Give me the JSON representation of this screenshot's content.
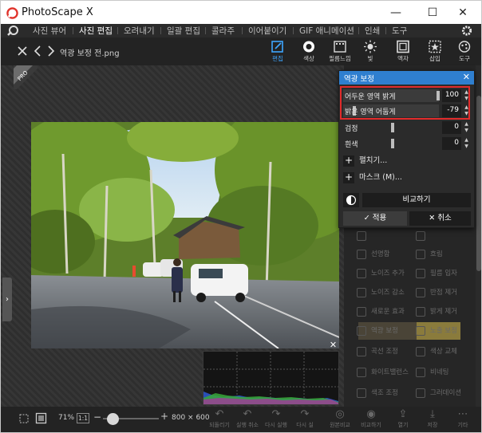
{
  "app": {
    "title": "PhotoScape X"
  },
  "window_controls": {
    "minimize": "—",
    "maximize": "☐",
    "close": "✕"
  },
  "menu": {
    "items": [
      {
        "label": "사진 뷰어",
        "active": false
      },
      {
        "label": "사진 편집",
        "active": true
      },
      {
        "label": "오려내기",
        "active": false
      },
      {
        "label": "일괄 편집",
        "active": false
      },
      {
        "label": "콜라주",
        "active": false
      },
      {
        "label": "이어붙이기",
        "active": false
      },
      {
        "label": "GIF 애니메이션",
        "active": false
      },
      {
        "label": "인쇄",
        "active": false
      },
      {
        "label": "도구",
        "active": false
      }
    ]
  },
  "toolbar": {
    "filename": "역광 보정 전.png",
    "tools": [
      {
        "label": "편집",
        "icon": "edit-icon",
        "active": true
      },
      {
        "label": "색상",
        "icon": "color-icon",
        "active": false
      },
      {
        "label": "필름느낌",
        "icon": "film-icon",
        "active": false
      },
      {
        "label": "빛",
        "icon": "light-icon",
        "active": false
      },
      {
        "label": "액자",
        "icon": "frame-icon",
        "active": false
      },
      {
        "label": "삽입",
        "icon": "insert-icon",
        "active": false
      },
      {
        "label": "도구",
        "icon": "tools-icon",
        "active": false
      }
    ]
  },
  "canvas": {
    "pro_badge": "PRO"
  },
  "dialog": {
    "title": "역광 보정",
    "sliders": [
      {
        "label": "어두운 영역 밝게",
        "value": "100",
        "level_fraction": 1.0
      },
      {
        "label": "밝은 영역 어둡게",
        "value": "-79",
        "level_fraction": 0.11
      },
      {
        "label": "검정",
        "value": "0",
        "level_fraction": 0.5
      },
      {
        "label": "흰색",
        "value": "0",
        "level_fraction": 0.5
      }
    ],
    "curve_label": "펼치기...",
    "mask_label": "마스크 (M)...",
    "compare_label": "비교하기",
    "apply_label": "적용",
    "cancel_label": "취소",
    "highlight_color": "#e22b2b",
    "header_color": "#2f7fd0"
  },
  "right_panel": {
    "items": [
      "선명함",
      "흐림",
      "노이즈 추가",
      "필름 입자",
      "노이즈 감소",
      "반점 제거",
      "새로운 효과",
      "밝게 제거",
      "역광 보정",
      "노출 보정",
      "곡선 조정",
      "색상 교체",
      "화이트밸런스",
      "비네팅",
      "색조 조정",
      "그러데이션"
    ]
  },
  "bottom": {
    "zoom": "71%",
    "one_to_one": "1:1",
    "minus": "−",
    "plus": "+",
    "dimensions": "800 × 600",
    "actions": [
      {
        "label": "되돌리기",
        "icon": "revert-icon"
      },
      {
        "label": "실행 취소",
        "icon": "undo-icon"
      },
      {
        "label": "다시 실행",
        "icon": "redo-icon"
      },
      {
        "label": "다시 실",
        "icon": "redo2-icon"
      },
      {
        "label": "원본비교",
        "icon": "compare-icon"
      },
      {
        "label": "비교하기",
        "icon": "compare2-icon"
      },
      {
        "label": "열기",
        "icon": "open-icon"
      },
      {
        "label": "저장",
        "icon": "save-icon"
      },
      {
        "label": "기타",
        "icon": "more-icon"
      }
    ]
  }
}
